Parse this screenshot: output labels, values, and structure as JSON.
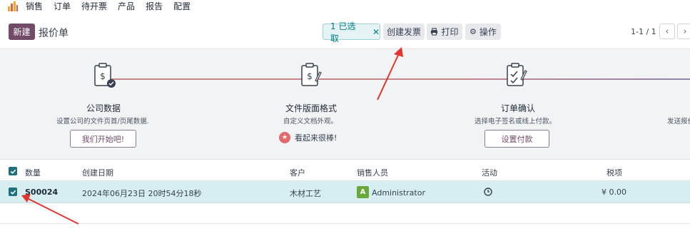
{
  "nav": {
    "items": [
      "销售",
      "订单",
      "待开票",
      "产品",
      "报告",
      "配置"
    ]
  },
  "control": {
    "new_label": "新建",
    "title": "报价单",
    "selected_label": "1 已选取",
    "create_invoice_label": "创建发票",
    "print_label": "打印",
    "actions_label": "操作",
    "pager_text": "1-1 / 1"
  },
  "onboarding": {
    "steps": [
      {
        "title": "公司数据",
        "desc": "设置公司的文件页首/页尾数据.",
        "button": "我们开始吧!"
      },
      {
        "title": "文件版面格式",
        "desc": "自定义文档外观。",
        "done_text": "看起来很棒!"
      },
      {
        "title": "订单确认",
        "desc": "选择电子签名或线上付款。",
        "button": "设置付款"
      },
      {
        "desc": "发送报价"
      }
    ]
  },
  "list": {
    "columns": [
      "数量",
      "创建日期",
      "客户",
      "销售人员",
      "活动",
      "税项"
    ],
    "rows": [
      {
        "number": "S00024",
        "created": "2024年06月23日 20时54分18秒",
        "customer": "木材工艺",
        "salesperson_initial": "A",
        "salesperson": "Administrator",
        "tax": "¥ 0.00"
      }
    ]
  },
  "colors": {
    "brand": "#714b67",
    "teal": "#017e84",
    "selected_row": "#d6eef0",
    "annotation_red": "#e3342f"
  }
}
